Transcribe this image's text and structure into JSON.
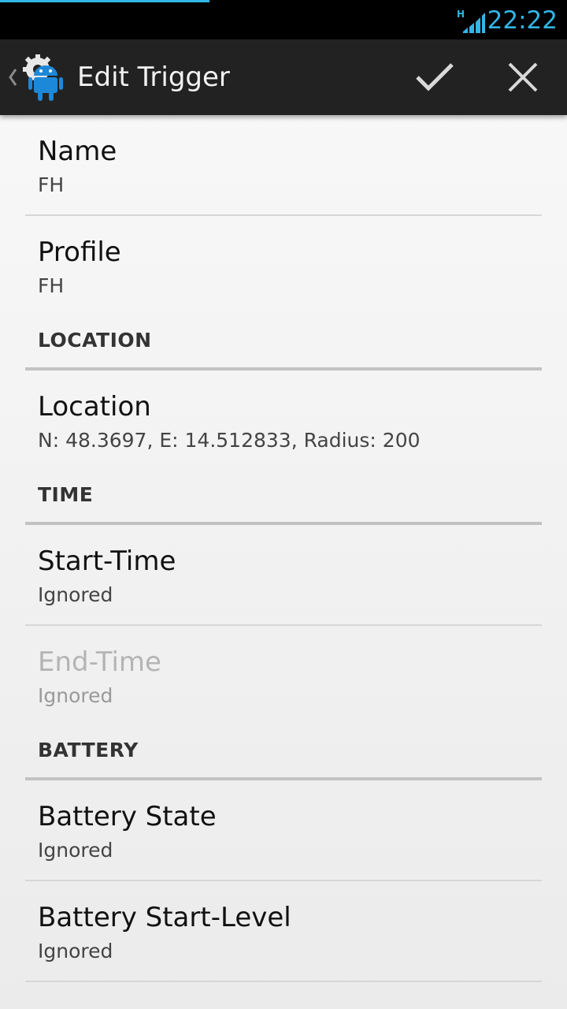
{
  "status_bar": {
    "network_type": "H",
    "time": "22:22",
    "accent_color": "#33b5e5"
  },
  "action_bar": {
    "title": "Edit Trigger",
    "icons": {
      "up": "chevron-left-icon",
      "app": "android-gear-icon",
      "confirm": "checkmark-icon",
      "cancel": "close-icon"
    }
  },
  "preferences": {
    "name": {
      "title": "Name",
      "summary": "FH"
    },
    "profile": {
      "title": "Profile",
      "summary": "FH"
    },
    "location_category": "LOCATION",
    "location": {
      "title": "Location",
      "summary": "N: 48.3697, E: 14.512833, Radius: 200"
    },
    "time_category": "TIME",
    "start_time": {
      "title": "Start-Time",
      "summary": "Ignored"
    },
    "end_time": {
      "title": "End-Time",
      "summary": "Ignored",
      "enabled": false
    },
    "battery_category": "BATTERY",
    "battery_state": {
      "title": "Battery State",
      "summary": "Ignored"
    },
    "battery_start_level": {
      "title": "Battery Start-Level",
      "summary": "Ignored"
    }
  }
}
